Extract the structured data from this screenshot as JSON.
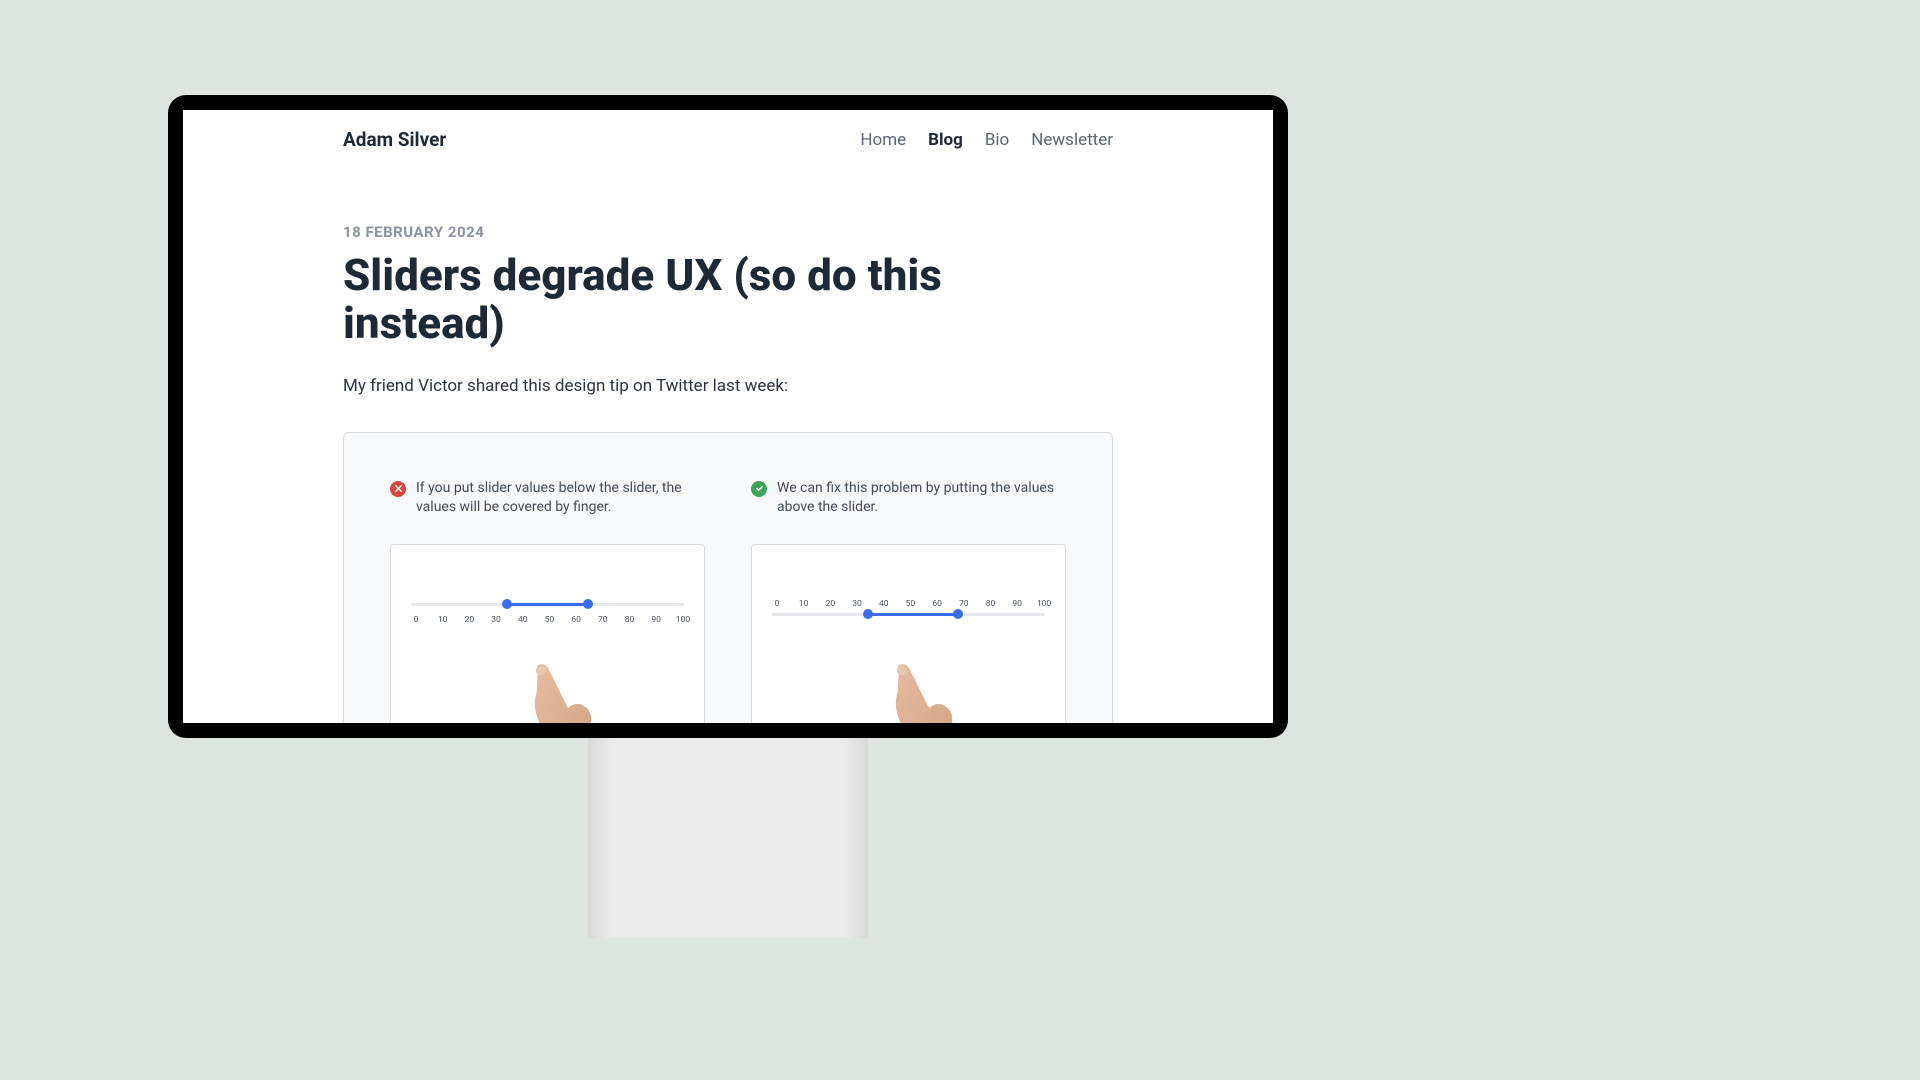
{
  "header": {
    "site_title": "Adam Silver",
    "nav": [
      {
        "label": "Home",
        "active": false
      },
      {
        "label": "Blog",
        "active": true
      },
      {
        "label": "Bio",
        "active": false
      },
      {
        "label": "Newsletter",
        "active": false
      }
    ]
  },
  "article": {
    "date": "18 FEBRUARY 2024",
    "title": "Sliders degrade UX (so do this instead)",
    "intro": "My friend Victor shared this design tip on Twitter last week:"
  },
  "example": {
    "bad_text": "If you put slider values below the slider, the values will be covered by finger.",
    "good_text": "We can fix this problem by putting the values above the slider.",
    "ticks": [
      "0",
      "10",
      "20",
      "30",
      "40",
      "50",
      "60",
      "70",
      "80",
      "90",
      "100"
    ]
  }
}
